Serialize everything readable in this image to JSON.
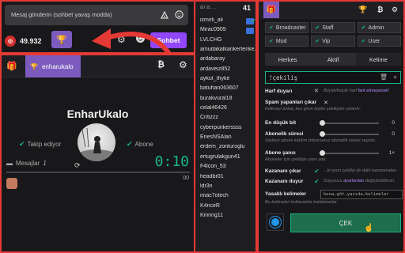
{
  "chat": {
    "placeholder": "Mesaj gönderin (sohbet yavaş modda)",
    "points": "49.932",
    "send_label": "Sohbet"
  },
  "plugin": {
    "tab_label": "enharukalo"
  },
  "duel": {
    "name": "EnharUkalo",
    "follow_left": "Takip ediyor",
    "follow_right": "Abone",
    "messages_label": "Mesajlar",
    "messages_count": "1",
    "timer": "0:10",
    "progress_fraction": 0,
    "zero": "00"
  },
  "userlist": {
    "header": "ara...",
    "count": "41",
    "users": [
      "izmirli_ali",
      "Mirac0909",
      "LVLCHG",
      "amudakalkankertenke...",
      "ardabaray",
      "ardaveiz852",
      "aykut_thyke",
      "batuhan063607",
      "burakvural18",
      "celal46426",
      "Critizzz",
      "cyberpunkerssss",
      "EnesNSAlan",
      "erdem_zonturoglu",
      "ertugrulakgun41",
      "F4lcon_53",
      "headbr01",
      "ldr3n",
      "imac7otech",
      "K4nceR",
      "Kinnng11"
    ]
  },
  "panel": {
    "roles": [
      "Broadcaster",
      "Staff",
      "Admin",
      "Mod",
      "Vip",
      "User"
    ],
    "tabs": [
      "Herkes",
      "Aktif",
      "Kelime"
    ],
    "keyword": "!çekiliş",
    "harf_label": "Harf duyarı",
    "harf_hint": "Büyük/küçük harf",
    "harf_hint_accent": "fark etmeyecek!",
    "spam_label": "Spam yapanları çıkar",
    "spam_hint": "Kelimeyi birkaç kez giren kişiler çekilişten çıkarılır.",
    "bit_label": "En düşük bit",
    "bit_value": "0",
    "abonelik_label": "Abonelik süresi",
    "abonelik_value": "0",
    "abonelik_hint": "Sadece abone katılım istiyorsanız abonelik süresi seçiniz.",
    "abone_sans_label": "Abone şansı",
    "abone_sans_value": "1×",
    "abone_sans_hint": "Aboneler için çekilişte şans yok.",
    "kazanan_cikar_label": "Kazananı çıkar",
    "kazanan_cikar_hint": "...ki oyun çekilişi de dahi kazananaları.",
    "kazanan_duyur_label": "Kazananı duyur",
    "kazanan_duyur_hint_a": "Duyurucu",
    "kazanan_duyur_hint_accent": "ayarlardan",
    "kazanan_duyur_hint_b": "değiştirebilirsin.",
    "yasakli_label": "Yasaklı kelimeler",
    "yasakli_placeholder": "buna,göt,yazıda,kelimeler",
    "yasakli_hint": "Bu kelimeleri kullananlar katılamazlar.",
    "cek_label": "ÇEK"
  }
}
